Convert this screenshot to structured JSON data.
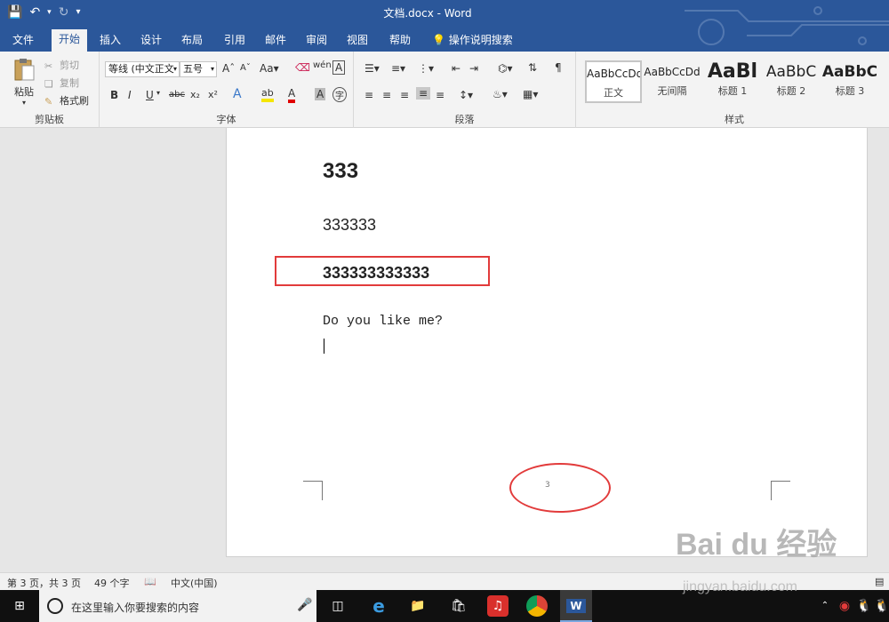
{
  "window": {
    "title": "文档.docx  -  Word"
  },
  "tabs": [
    {
      "label": "文件"
    },
    {
      "label": "开始"
    },
    {
      "label": "插入"
    },
    {
      "label": "设计"
    },
    {
      "label": "布局"
    },
    {
      "label": "引用"
    },
    {
      "label": "邮件"
    },
    {
      "label": "审阅"
    },
    {
      "label": "视图"
    },
    {
      "label": "帮助"
    }
  ],
  "tell_me": "操作说明搜索",
  "ribbon": {
    "clipboard": {
      "paste": "粘贴",
      "cut": "剪切",
      "copy": "复制",
      "format_painter": "格式刷",
      "group_label": "剪贴板"
    },
    "font": {
      "font_name": "等线 (中文正文",
      "font_size": "五号",
      "group_label": "字体"
    },
    "paragraph": {
      "group_label": "段落"
    },
    "styles": {
      "group_label": "样式",
      "items": [
        {
          "preview": "AaBbCcDd",
          "name": "正文"
        },
        {
          "preview": "AaBbCcDd",
          "name": "无间隔"
        },
        {
          "preview": "AaBl",
          "name": "标题 1"
        },
        {
          "preview": "AaBbC",
          "name": "标题 2"
        },
        {
          "preview": "AaBbC",
          "name": "标题 3"
        }
      ]
    }
  },
  "document": {
    "heading": "333",
    "para1": "333333",
    "para2": "333333333333",
    "para3": "Do you like me?",
    "page_number": "3"
  },
  "status": {
    "page": "第 3 页，共 3 页",
    "words": "49 个字",
    "language": "中文(中国)"
  },
  "taskbar": {
    "search_placeholder": "在这里输入你要搜索的内容"
  },
  "watermark": {
    "brand": "Bai du 经验",
    "url": "jingyan.baidu.com"
  },
  "colors": {
    "word_blue": "#2b579a",
    "annotation_red": "#e23b3b"
  }
}
